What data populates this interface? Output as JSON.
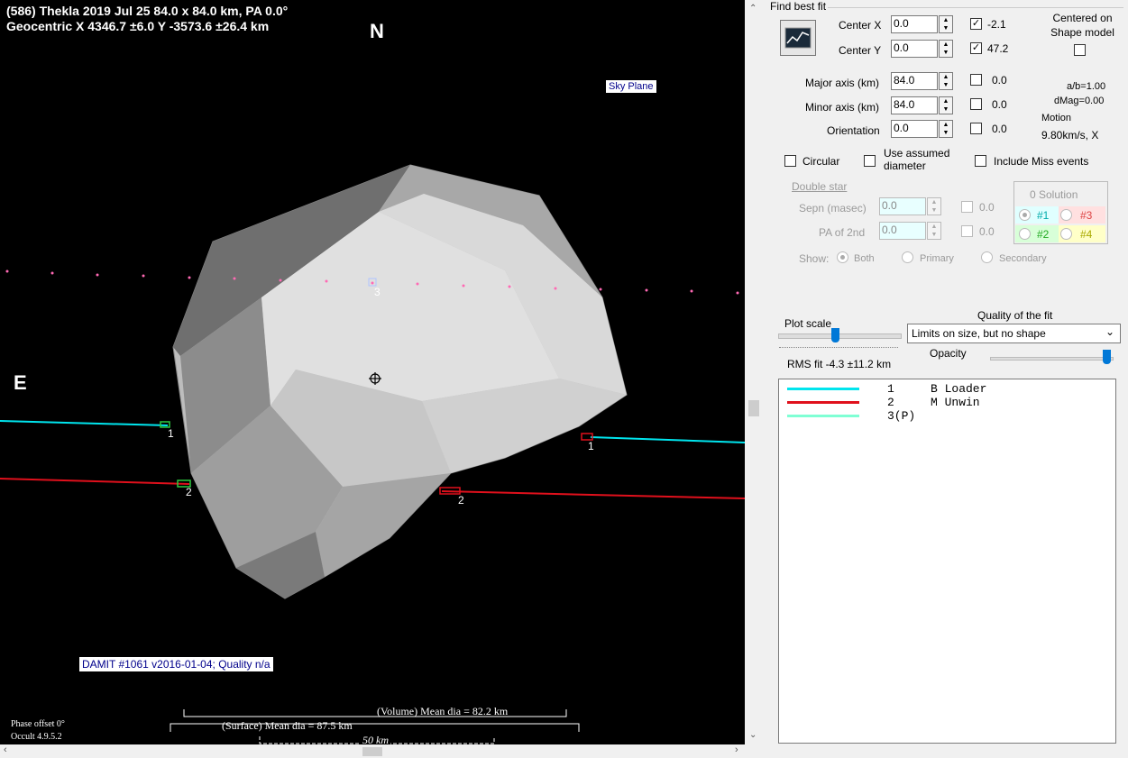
{
  "plot": {
    "header_line1": "(586) Thekla  2019 Jul 25   84.0 x 84.0 km,  PA 0.0°",
    "header_line2": "Geocentric  X  4346.7 ±6.0  Y  -3573.6 ±26.4 km",
    "north": "N",
    "east": "E",
    "sky_plane": "Sky Plane",
    "model_label": "DAMIT #1061 v2016-01-04; Quality n/a",
    "chord_labels": [
      "1",
      "2",
      "1",
      "2",
      "3"
    ],
    "phase_offset": "Phase offset 0°",
    "version": "Occult 4.9.5.2",
    "volume_dia": "(Volume) Mean dia = 82.2 km",
    "surface_dia": "(Surface) Mean dia = 87.5 km",
    "scale_bar": "50 km",
    "colors": {
      "chord1": "#00e5ee",
      "chord2": "#e0101c",
      "path3": "#ff69b4",
      "background": "#000000"
    }
  },
  "panel": {
    "find_best_fit": "Find best fit",
    "fit_icon": "chart-fit-icon",
    "center_x_label": "Center X",
    "center_x_value": "0.0",
    "center_x_fit": "-2.1",
    "center_y_label": "Center Y",
    "center_y_value": "0.0",
    "center_y_fit": "47.2",
    "centered_on_label": "Centered on Shape model",
    "major_label": "Major axis (km)",
    "major_value": "84.0",
    "major_fit": "0.0",
    "minor_label": "Minor axis (km)",
    "minor_value": "84.0",
    "minor_fit": "0.0",
    "orient_label": "Orientation",
    "orient_value": "0.0",
    "orient_fit": "0.0",
    "ab_ratio": "a/b=1.00",
    "dmag": "dMag=0.00",
    "motion_label": "Motion",
    "motion_value": "9.80km/s, X",
    "circular": "Circular",
    "use_assumed": "Use assumed diameter",
    "include_miss": "Include Miss events",
    "double_star": "Double star",
    "sepn_label": "Sepn (masec)",
    "sepn_value": "0.0",
    "sepn_fit": "0.0",
    "pa2_label": "PA of 2nd",
    "pa2_value": "0.0",
    "pa2_fit": "0.0",
    "show_label": "Show:",
    "show_both": "Both",
    "show_primary": "Primary",
    "show_secondary": "Secondary",
    "solution_title": "0 Solution",
    "sol1": "#1",
    "sol2": "#2",
    "sol3": "#3",
    "sol4": "#4",
    "plot_scale": "Plot scale",
    "quality_title": "Quality of the fit",
    "quality_value": "Limits on size, but no shape",
    "opacity": "Opacity",
    "rms_fit": "RMS fit -4.3 ±11.2 km"
  },
  "legend": [
    {
      "num": "1",
      "observer": "B Loader",
      "color": "#00e5ee"
    },
    {
      "num": "2",
      "observer": "M Unwin",
      "color": "#e0101c"
    },
    {
      "num": "3(P)",
      "observer": "",
      "color": "#7fffd4"
    }
  ]
}
